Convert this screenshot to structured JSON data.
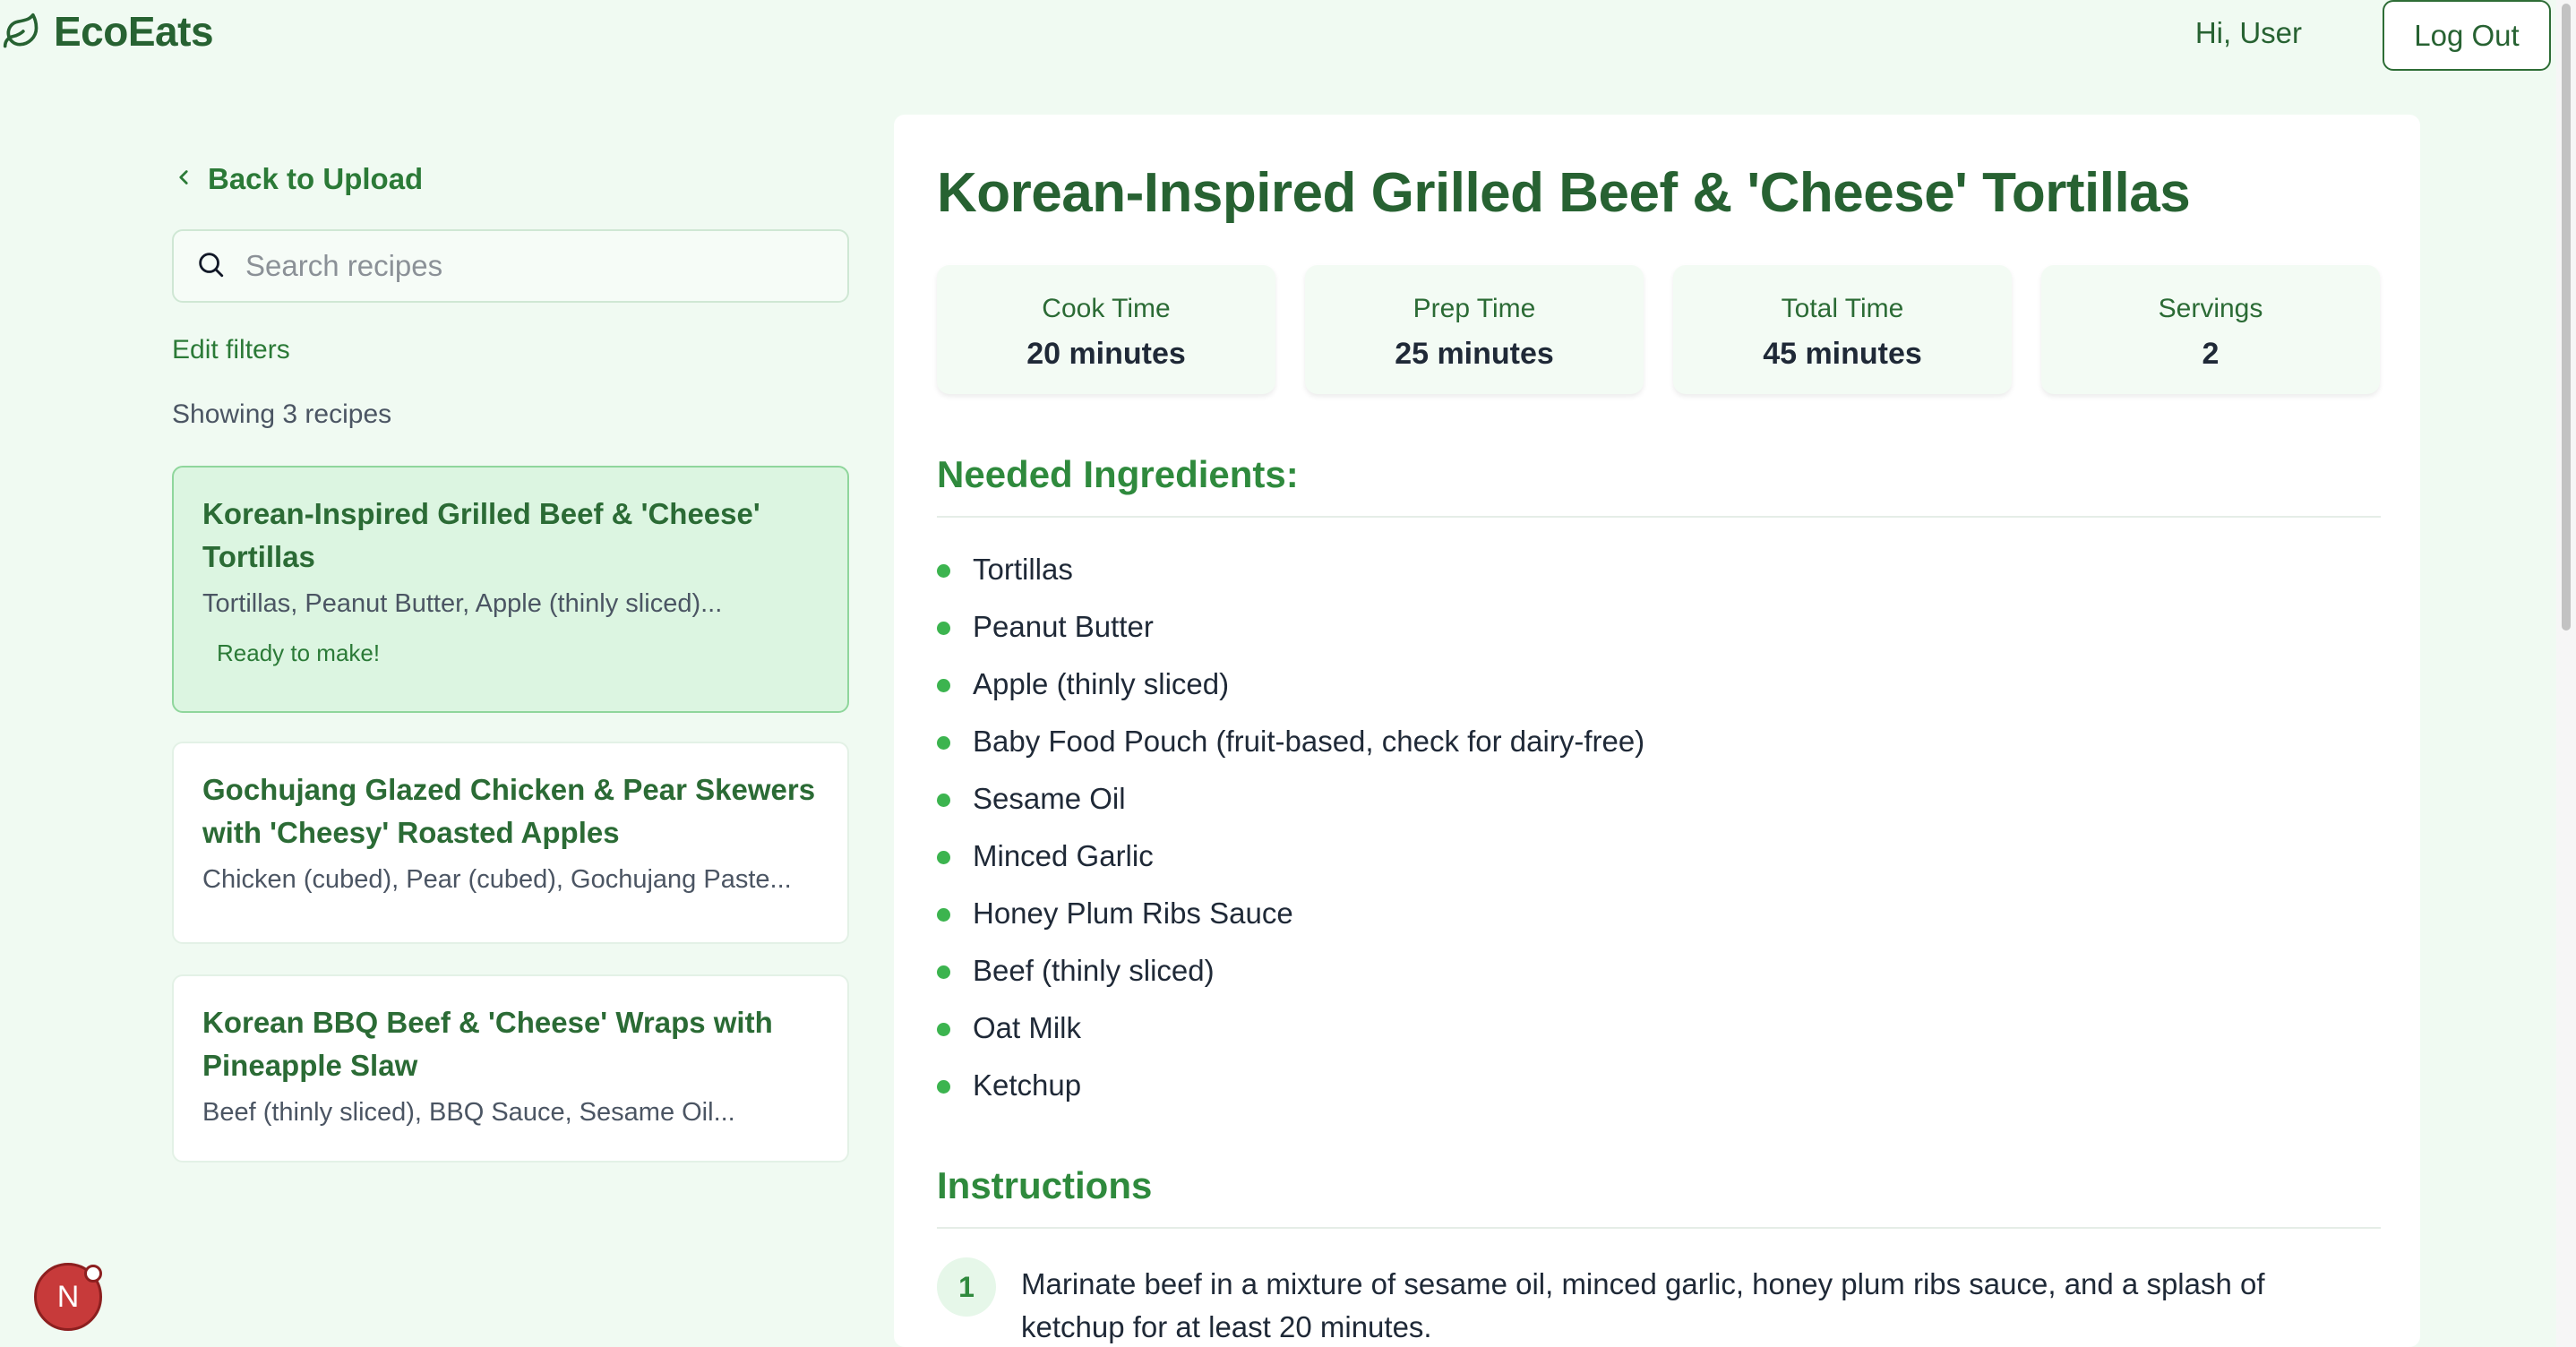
{
  "header": {
    "app_name": "EcoEats",
    "greeting": "Hi, User",
    "logout_label": "Log Out",
    "logo_icon": "leaf-icon"
  },
  "sidebar": {
    "back_label": "Back to Upload",
    "search_placeholder": "Search recipes",
    "search_value": "",
    "edit_filters_label": "Edit filters",
    "showing_text": "Showing 3 recipes",
    "recipes": [
      {
        "title": "Korean-Inspired Grilled Beef & 'Cheese' Tortillas",
        "ingredients_preview": "Tortillas, Peanut Butter, Apple (thinly sliced)...",
        "badge": "Ready to make!",
        "selected": true
      },
      {
        "title": "Gochujang Glazed Chicken & Pear Skewers with 'Cheesy' Roasted Apples",
        "ingredients_preview": "Chicken (cubed), Pear (cubed), Gochujang Paste...",
        "badge": "",
        "selected": false
      },
      {
        "title": "Korean BBQ Beef & 'Cheese' Wraps with Pineapple Slaw",
        "ingredients_preview": "Beef (thinly sliced), BBQ Sauce, Sesame Oil...",
        "badge": "",
        "selected": false
      }
    ]
  },
  "recipe_detail": {
    "title": "Korean-Inspired Grilled Beef & 'Cheese' Tortillas",
    "stats": [
      {
        "label": "Cook Time",
        "value": "20 minutes"
      },
      {
        "label": "Prep Time",
        "value": "25 minutes"
      },
      {
        "label": "Total Time",
        "value": "45 minutes"
      },
      {
        "label": "Servings",
        "value": "2"
      }
    ],
    "ingredients_heading": "Needed Ingredients:",
    "ingredients": [
      "Tortillas",
      "Peanut Butter",
      "Apple (thinly sliced)",
      "Baby Food Pouch (fruit-based, check for dairy-free)",
      "Sesame Oil",
      "Minced Garlic",
      "Honey Plum Ribs Sauce",
      "Beef (thinly sliced)",
      "Oat Milk",
      "Ketchup"
    ],
    "instructions_heading": "Instructions",
    "instructions": [
      {
        "number": "1",
        "text": "Marinate beef in a mixture of sesame oil, minced garlic, honey plum ribs sauce, and a splash of ketchup for at least 20 minutes."
      }
    ]
  },
  "avatar": {
    "initial": "N"
  },
  "colors": {
    "page_background": "#f0faf2",
    "brand_green": "#276232",
    "accent_green": "#2f8a3d",
    "bullet_green": "#3cb44f",
    "selected_card_bg": "#dcf5e1",
    "avatar_red": "#c73a3a"
  }
}
